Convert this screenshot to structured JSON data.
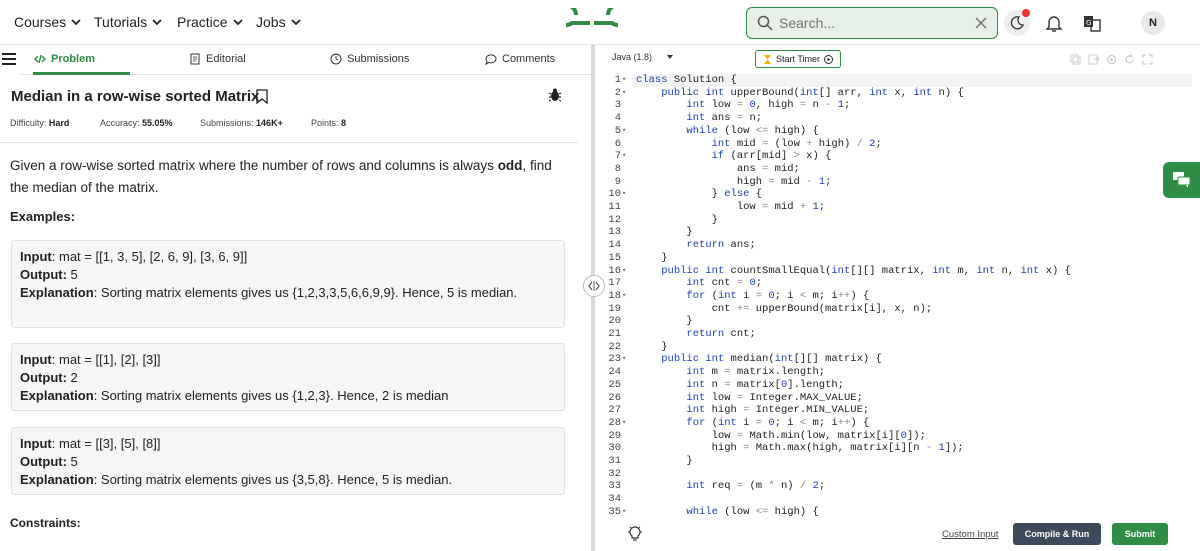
{
  "nav": {
    "items": [
      {
        "label": "Courses"
      },
      {
        "label": "Tutorials"
      },
      {
        "label": "Practice"
      },
      {
        "label": "Jobs"
      }
    ],
    "search_placeholder": "Search...",
    "avatar_initial": "N",
    "brand_color": "#2f8d46"
  },
  "tabs": [
    {
      "label": "Problem",
      "icon": "code-icon"
    },
    {
      "label": "Editorial",
      "icon": "document-icon"
    },
    {
      "label": "Submissions",
      "icon": "clock-icon"
    },
    {
      "label": "Comments",
      "icon": "comment-icon"
    }
  ],
  "problem": {
    "title": "Median in a row-wise sorted Matrix",
    "difficulty_label": "Difficulty:",
    "difficulty": "Hard",
    "accuracy_label": "Accuracy:",
    "accuracy": "55.05%",
    "submissions_label": "Submissions:",
    "submissions": "146K+",
    "points_label": "Points:",
    "points": "8",
    "description_pre": "Given a row-wise sorted matrix where the number of rows and columns is always ",
    "description_bold": "odd",
    "description_post": ", find the median of the matrix.",
    "examples_heading": "Examples:",
    "examples": [
      {
        "input_label": "Input",
        "input": ": mat = [[1, 3, 5], [2, 6, 9], [3, 6, 9]]",
        "output_label": "Output:",
        "output": " 5",
        "explanation_label": "Explanation",
        "explanation": ": Sorting matrix elements gives us {1,2,3,3,5,6,6,9,9}. Hence, 5 is median."
      },
      {
        "input_label": "Input",
        "input": ": mat = [[1], [2], [3]]",
        "output_label": "Output:",
        "output": " 2",
        "explanation_label": "Explanation",
        "explanation": ": Sorting matrix elements gives us {1,2,3}. Hence, 2 is median"
      },
      {
        "input_label": "Input",
        "input": ": mat = [[3], [5], [8]]",
        "output_label": "Output:",
        "output": " 5",
        "explanation_label": "Explanation",
        "explanation": ": Sorting matrix elements gives us {3,5,8}. Hence, 5 is median."
      }
    ],
    "constraints_heading": "Constraints:"
  },
  "editor": {
    "language": "Java (1.8)",
    "timer_label": "Start Timer",
    "custom_input_label": "Custom Input",
    "compile_label": "Compile & Run",
    "submit_label": "Submit",
    "lines": [
      "class Solution {",
      "    public int upperBound(int[] arr, int x, int n) {",
      "        int low = 0, high = n - 1;",
      "        int ans = n;",
      "        while (low <= high) {",
      "            int mid = (low + high) / 2;",
      "            if (arr[mid] > x) {",
      "                ans = mid;",
      "                high = mid - 1;",
      "            } else {",
      "                low = mid + 1;",
      "            }",
      "        }",
      "        return ans;",
      "    }",
      "    public int countSmallEqual(int[][] matrix, int m, int n, int x) {",
      "        int cnt = 0;",
      "        for (int i = 0; i < m; i++) {",
      "            cnt += upperBound(matrix[i], x, n);",
      "        }",
      "        return cnt;",
      "    }",
      "    public int median(int[][] matrix) {",
      "        int m = matrix.length;",
      "        int n = matrix[0].length;",
      "        int low = Integer.MAX_VALUE;",
      "        int high = Integer.MIN_VALUE;",
      "        for (int i = 0; i < m; i++) {",
      "            low = Math.min(low, matrix[i][0]);",
      "            high = Math.max(high, matrix[i][n - 1]);",
      "        }",
      "",
      "        int req = (m * n) / 2;",
      "",
      "        while (low <= high) {"
    ],
    "fold_lines": [
      1,
      2,
      5,
      7,
      10,
      16,
      18,
      23,
      28,
      35
    ]
  }
}
